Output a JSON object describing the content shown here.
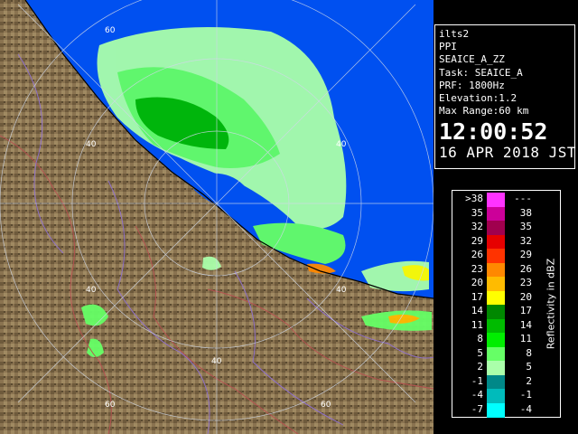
{
  "info": {
    "station": "ilts2",
    "mode": "PPI",
    "product": "SEAICE_A_ZZ",
    "task": "Task: SEAICE_A",
    "prf": "PRF: 1800Hz",
    "elevation": "Elevation:1.2",
    "max_range": "Max Range:60 km",
    "time": "12:00:52",
    "date": "16 APR 2018 JST"
  },
  "range_ring_labels": [
    "60",
    "40",
    "40",
    "40",
    "40",
    "40",
    "60",
    "60"
  ],
  "legend": {
    "title": "Reflectivity in dBZ",
    "rows": [
      {
        "lo": ">38",
        "hi": "---",
        "color": "#ff33ff"
      },
      {
        "lo": "35",
        "hi": "38",
        "color": "#cc0099"
      },
      {
        "lo": "32",
        "hi": "35",
        "color": "#a0004e"
      },
      {
        "lo": "29",
        "hi": "32",
        "color": "#e60000"
      },
      {
        "lo": "26",
        "hi": "29",
        "color": "#ff3300"
      },
      {
        "lo": "23",
        "hi": "26",
        "color": "#ff8800"
      },
      {
        "lo": "20",
        "hi": "23",
        "color": "#ffbb00"
      },
      {
        "lo": "17",
        "hi": "20",
        "color": "#ffff00"
      },
      {
        "lo": "14",
        "hi": "17",
        "color": "#008800"
      },
      {
        "lo": "11",
        "hi": "14",
        "color": "#00bb00"
      },
      {
        "lo": "8",
        "hi": "11",
        "color": "#00ee00"
      },
      {
        "lo": "5",
        "hi": "8",
        "color": "#66ff66"
      },
      {
        "lo": "2",
        "hi": "5",
        "color": "#aaffaa"
      },
      {
        "lo": "-1",
        "hi": "2",
        "color": "#008888"
      },
      {
        "lo": "-4",
        "hi": "-1",
        "color": "#00bbbb"
      },
      {
        "lo": "-7",
        "hi": "-4",
        "color": "#00ffff"
      }
    ]
  },
  "colors": {
    "sea": "#0050f0",
    "land": "#8a7350",
    "echo_light": "#aaffaa",
    "echo_mid": "#66ff66",
    "echo_strong": "#00bb00"
  }
}
